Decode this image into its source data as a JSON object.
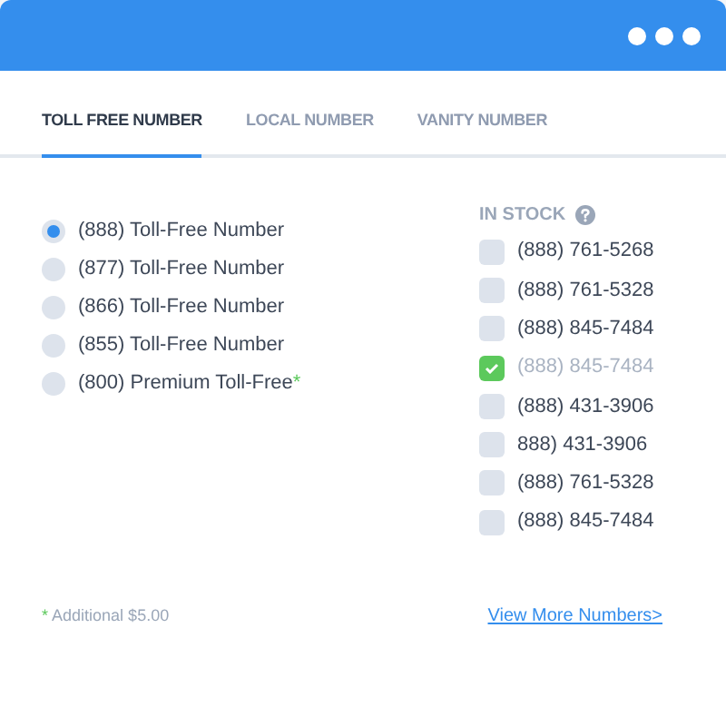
{
  "tabs": [
    {
      "label": "TOLL FREE NUMBER",
      "selected": true
    },
    {
      "label": "LOCAL NUMBER",
      "selected": false
    },
    {
      "label": "VANITY NUMBER",
      "selected": false
    }
  ],
  "number_types": [
    {
      "label": "(888) Toll-Free Number",
      "selected": true
    },
    {
      "label": "(877) Toll-Free Number",
      "selected": false
    },
    {
      "label": "(866) Toll-Free Number",
      "selected": false
    },
    {
      "label": "(855) Toll-Free Number",
      "selected": false
    },
    {
      "label": "(800) Premium Toll-Free",
      "mark": "*",
      "selected": false
    }
  ],
  "stock": {
    "title": "IN STOCK",
    "numbers": [
      {
        "label": "(888) 761-5268",
        "checked": false
      },
      {
        "label": "(888) 761-5328",
        "checked": false
      },
      {
        "label": "(888) 845-7484",
        "checked": false
      },
      {
        "label": "(888) 845-7484",
        "checked": true
      },
      {
        "label": "(888) 431-3906",
        "checked": false
      },
      {
        "label": "888) 431-3906",
        "checked": false
      },
      {
        "label": "(888) 761-5328",
        "checked": false
      },
      {
        "label": "(888) 845-7484",
        "checked": false
      }
    ]
  },
  "footnote": {
    "mark": "*",
    "text": "Additional $5.00"
  },
  "link": "View More Numbers>"
}
